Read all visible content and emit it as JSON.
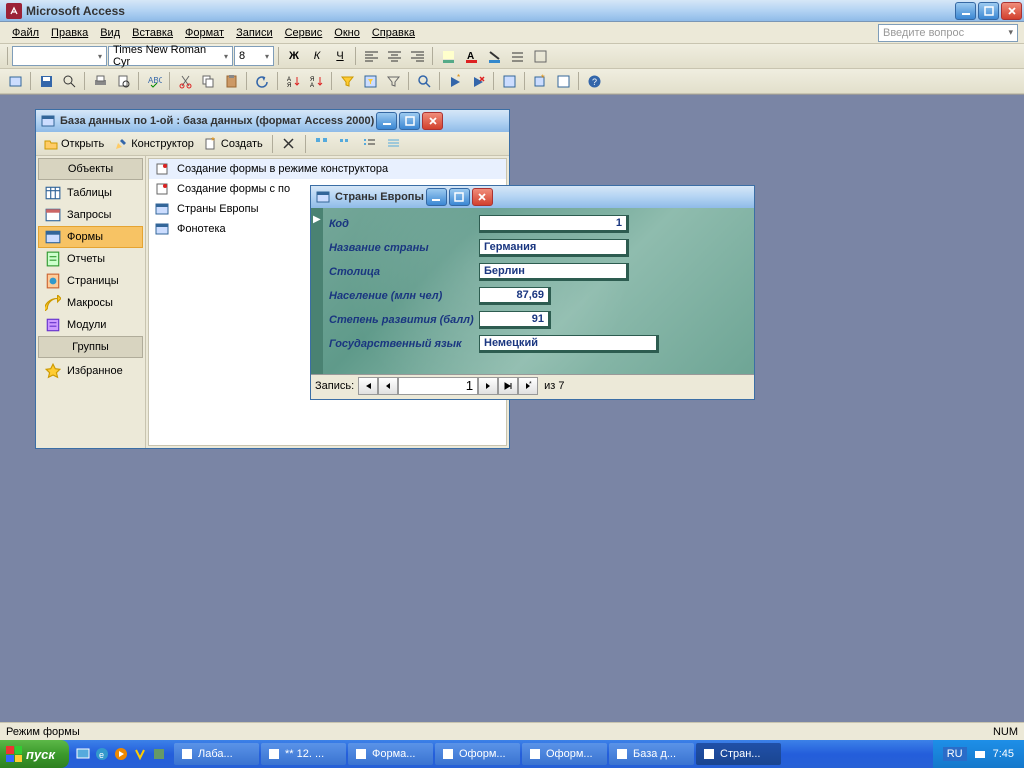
{
  "app": {
    "title": "Microsoft Access"
  },
  "menu": [
    "Файл",
    "Правка",
    "Вид",
    "Вставка",
    "Формат",
    "Записи",
    "Сервис",
    "Окно",
    "Справка"
  ],
  "help_placeholder": "Введите вопрос",
  "toolbar": {
    "font_name": "Times New Roman Cyr",
    "font_size": "8"
  },
  "db_window": {
    "title": "База данных по 1-ой : база данных (формат Access 2000)",
    "buttons": {
      "open": "Открыть",
      "design": "Конструктор",
      "new": "Создать"
    },
    "groups": {
      "objects": "Объекты",
      "groups": "Группы"
    },
    "sidebar": [
      {
        "label": "Таблицы",
        "icon": "table"
      },
      {
        "label": "Запросы",
        "icon": "query"
      },
      {
        "label": "Формы",
        "icon": "form",
        "selected": true
      },
      {
        "label": "Отчеты",
        "icon": "report"
      },
      {
        "label": "Страницы",
        "icon": "page"
      },
      {
        "label": "Макросы",
        "icon": "macro"
      },
      {
        "label": "Модули",
        "icon": "module"
      }
    ],
    "favorites": "Избранное",
    "list": [
      {
        "label": "Создание формы в режиме конструктора",
        "icon": "wizard"
      },
      {
        "label": "Создание формы с по",
        "icon": "wizard"
      },
      {
        "label": "Страны Европы",
        "icon": "form"
      },
      {
        "label": "Фонотека",
        "icon": "form"
      }
    ]
  },
  "form_window": {
    "title": "Страны Европы",
    "fields": [
      {
        "label": "Код",
        "value": "1",
        "cls": "f-code"
      },
      {
        "label": "Название страны",
        "value": "Германия",
        "cls": "f-name"
      },
      {
        "label": "Столица",
        "value": "Берлин",
        "cls": "f-name"
      },
      {
        "label": "Население (млн чел)",
        "value": "87,69",
        "cls": "f-num"
      },
      {
        "label": "Степень развития (балл)",
        "value": "91",
        "cls": "f-num"
      },
      {
        "label": "Государственный язык",
        "value": "Немецкий",
        "cls": "f-lang"
      }
    ],
    "nav": {
      "label": "Запись:",
      "current": "1",
      "of": "из  7"
    }
  },
  "statusbar": {
    "mode": "Режим формы",
    "num": "NUM"
  },
  "taskbar": {
    "start": "пуск",
    "items": [
      {
        "label": "Лаба..."
      },
      {
        "label": "** 12. ..."
      },
      {
        "label": "Форма..."
      },
      {
        "label": "Оформ..."
      },
      {
        "label": "Оформ..."
      },
      {
        "label": "База д..."
      },
      {
        "label": "Стран...",
        "active": true
      }
    ],
    "lang": "RU",
    "time": "7:45"
  }
}
